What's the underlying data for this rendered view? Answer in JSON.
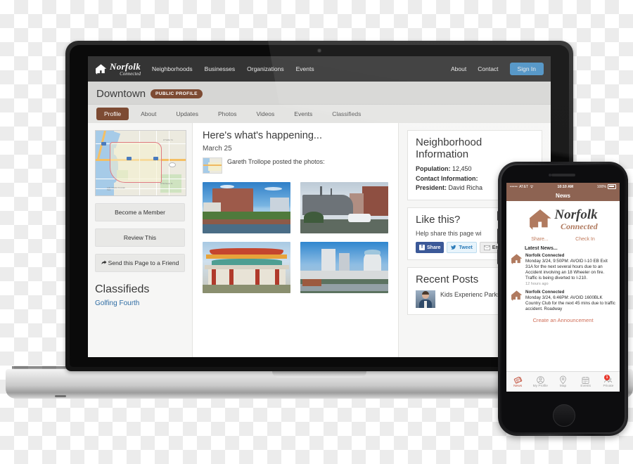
{
  "site": {
    "brand": {
      "name": "Norfolk",
      "tagline": "Connected",
      "icon": "home-icon"
    },
    "nav": [
      {
        "label": "Neighborhoods"
      },
      {
        "label": "Businesses"
      },
      {
        "label": "Organizations"
      },
      {
        "label": "Events"
      }
    ],
    "nav_right": [
      {
        "label": "About"
      },
      {
        "label": "Contact"
      }
    ],
    "sign_in_label": "Sign In",
    "sign_in_color": "#4a90c4"
  },
  "page": {
    "title": "Downtown",
    "badge": "PUBLIC PROFILE",
    "badge_color": "#7d4b33",
    "tabs": [
      {
        "label": "Profile",
        "active": true
      },
      {
        "label": "About",
        "active": false
      },
      {
        "label": "Updates",
        "active": false
      },
      {
        "label": "Photos",
        "active": false
      },
      {
        "label": "Videos",
        "active": false
      },
      {
        "label": "Events",
        "active": false
      },
      {
        "label": "Classifieds",
        "active": false
      }
    ]
  },
  "sidebar": {
    "map_alt": "neighborhood-boundary-map",
    "map_labels": [
      "W Sallier St",
      "Lake Charles Fountain Park",
      "W McNeese St"
    ],
    "buttons": [
      {
        "label": "Become a Member",
        "icon": null
      },
      {
        "label": "Review This",
        "icon": null
      },
      {
        "label": "Send this Page to a Friend",
        "icon": "share-arrow-icon"
      }
    ],
    "classifieds_heading": "Classifieds",
    "classifieds_items": [
      {
        "label": "Golfing Fourth",
        "color": "#2f6da4"
      }
    ]
  },
  "feed": {
    "heading": "Here's what's happening...",
    "date": "March 25",
    "activity": "Gareth Trollope posted the photos:",
    "photos": [
      {
        "alt": "waterfront-brick-condos"
      },
      {
        "alt": "battleship-wisconsin-waterside"
      },
      {
        "alt": "chinese-pagoda-pavilion"
      },
      {
        "alt": "downtown-skyline-canal"
      }
    ]
  },
  "info_panel": {
    "heading": "Neighborhood Information",
    "population_label": "Population:",
    "population_value": "12,450",
    "contact_label": "Contact Information:",
    "president_label": "President:",
    "president_value": "David Richa"
  },
  "like_panel": {
    "heading": "Like this?",
    "subtext": "Help share this page wi",
    "buttons": [
      {
        "label": "Share",
        "icon": "facebook-icon",
        "color": "#3b5998"
      },
      {
        "label": "Tweet",
        "icon": "twitter-icon",
        "color": "#2b7bb9"
      },
      {
        "label": "Email",
        "icon": "envelope-icon",
        "color": "#444444"
      }
    ]
  },
  "recent_posts": {
    "heading": "Recent Posts",
    "items": [
      {
        "title": "Kids Experienc Parks",
        "avatar": "post-author-avatar"
      }
    ]
  },
  "phone": {
    "status": {
      "carrier": "AT&T",
      "signal_dots": "•••••",
      "wifi": "wifi-icon",
      "time": "10:10 AM",
      "battery": "100%"
    },
    "nav_title": "News",
    "brand": {
      "name": "Norfolk",
      "tagline": "Connected",
      "icon": "home-icon",
      "color": "#b07a5f"
    },
    "actions": [
      {
        "label": "Share..."
      },
      {
        "label": "Check In"
      }
    ],
    "latest_heading": "Latest News...",
    "news": [
      {
        "source": "Norfolk Connected",
        "body": "Monday 3/24, 9:50PM: AVOID I-10 EB Exit 31A for the next several hours due to an Accident involving an 18 Wheeler on fire. Traffic is being diverted to I-210.",
        "time": "12 hours ago"
      },
      {
        "source": "Norfolk Connected",
        "body": "Monday 3/24, 6:46PM: AVOID 1600BLK Country Club for the next 45 mins due to traffic accident. Roadway",
        "time": ""
      }
    ],
    "cta": "Create an Announcement",
    "tabs": [
      {
        "label": "News",
        "icon": "newspaper-icon",
        "glyph": "🗞",
        "active": true,
        "badge": ""
      },
      {
        "label": "My Profile",
        "icon": "person-circle-icon",
        "glyph": "⓪",
        "active": false,
        "badge": ""
      },
      {
        "label": "Map",
        "icon": "map-pin-icon",
        "glyph": "◎",
        "active": false,
        "badge": ""
      },
      {
        "label": "Events",
        "icon": "calendar-icon",
        "glyph": "▦",
        "active": false,
        "badge": ""
      },
      {
        "label": "Private",
        "icon": "group-icon",
        "glyph": "◔",
        "active": false,
        "badge": "1"
      }
    ],
    "badge_color": "#e8352a"
  }
}
